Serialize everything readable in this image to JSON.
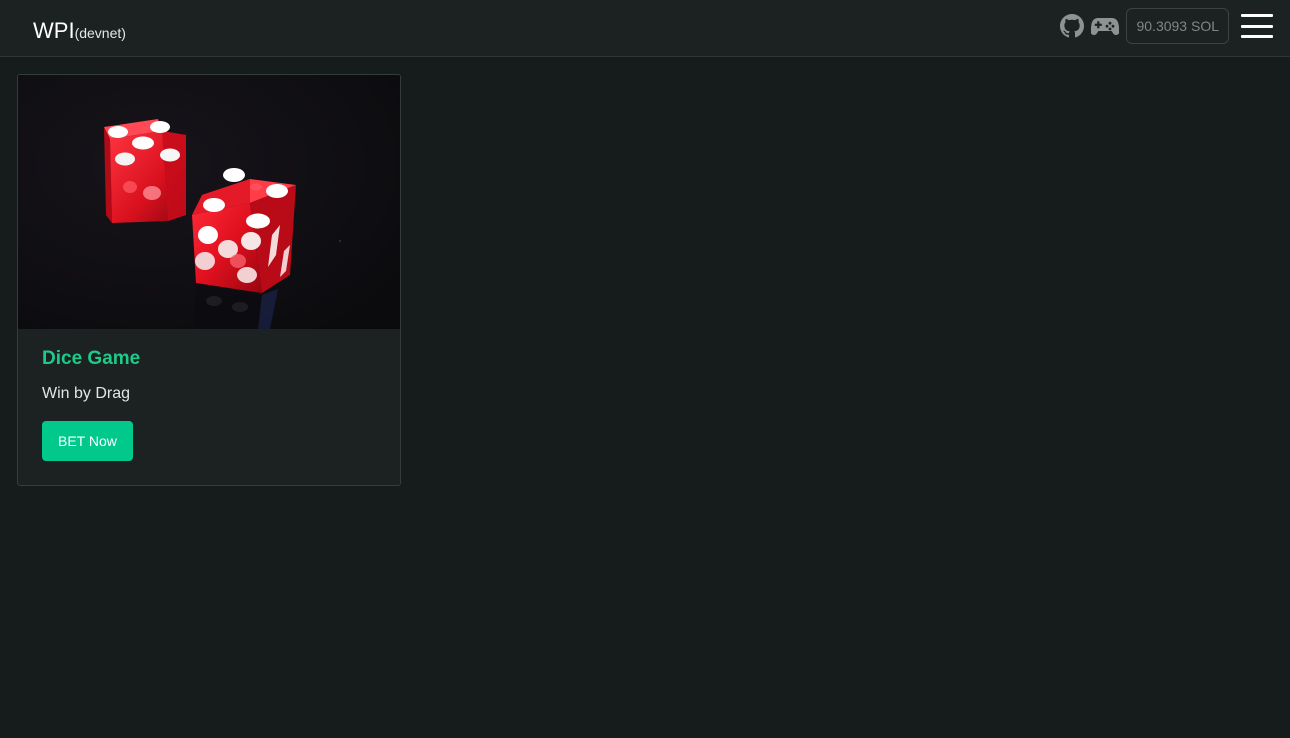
{
  "navbar": {
    "brand": "WPI",
    "brand_sub": "(devnet)",
    "github_icon": "github-icon",
    "gamepad_icon": "gamepad-icon",
    "balance": "90.3093 SOL",
    "menu_icon": "hamburger-menu-icon"
  },
  "cards": [
    {
      "image": "red-dice-photo",
      "title": "Dice Game",
      "subtitle": "Win by Drag",
      "button_label": "BET Now"
    }
  ],
  "colors": {
    "background": "#151c1b",
    "navbar": "#1b2221",
    "accent": "#00c98b",
    "title_green": "#1fc98a"
  }
}
